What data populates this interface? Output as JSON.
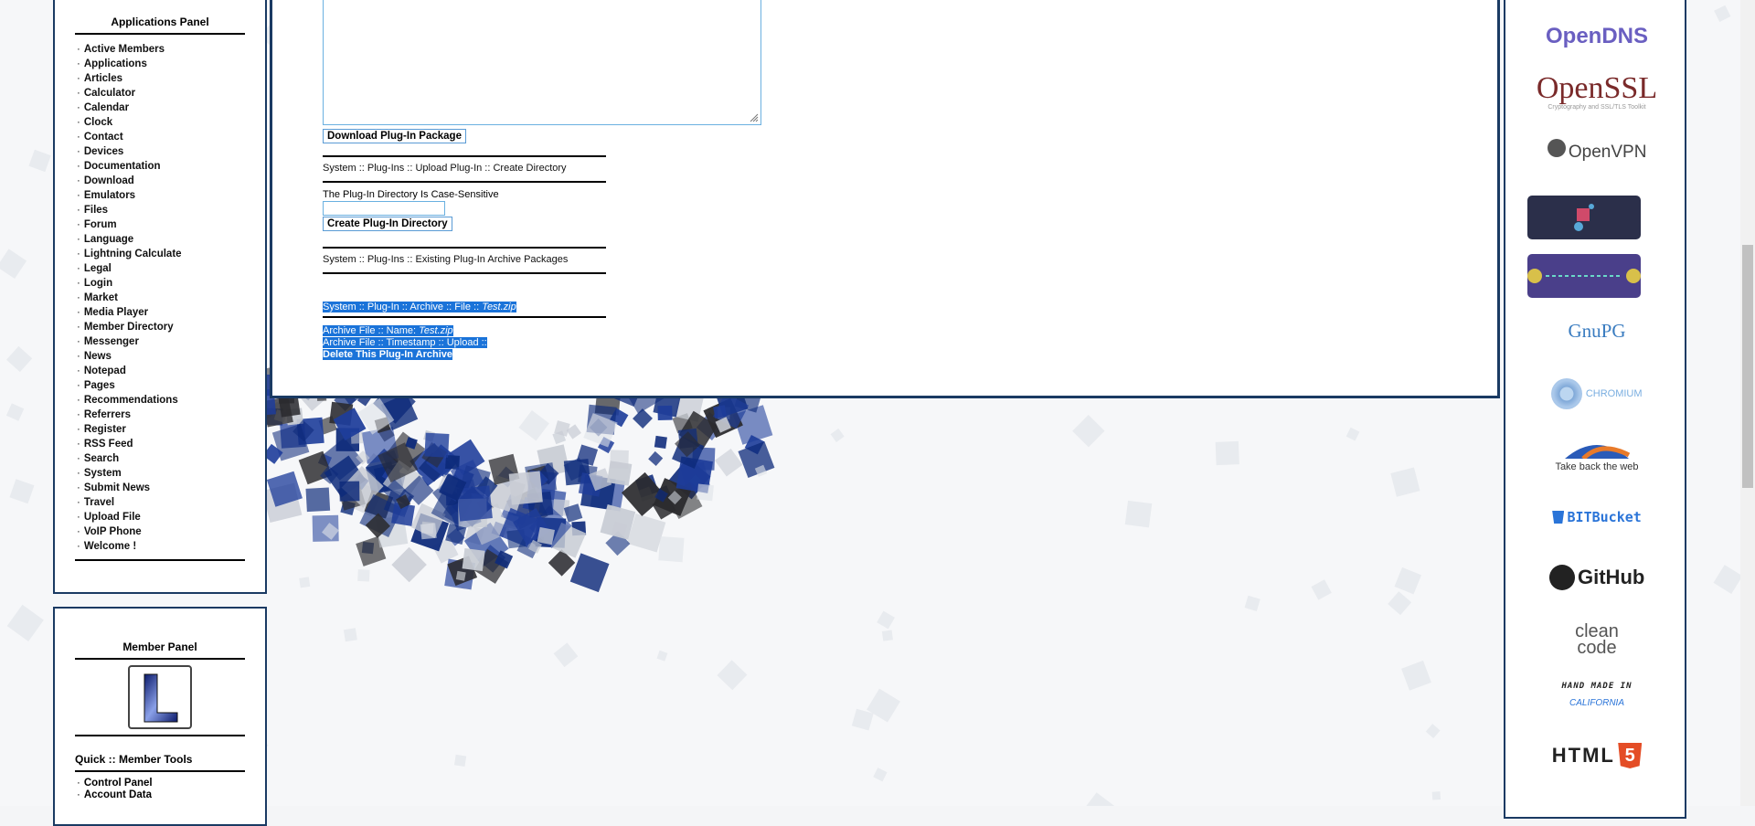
{
  "applications_panel": {
    "title": "Applications Panel",
    "items": [
      "Active Members",
      "Applications",
      "Articles",
      "Calculator",
      "Calendar",
      "Clock",
      "Contact",
      "Devices",
      "Documentation",
      "Download",
      "Emulators",
      "Files",
      "Forum",
      "Language",
      "Lightning Calculate",
      "Legal",
      "Login",
      "Market",
      "Media Player",
      "Member Directory",
      "Messenger",
      "News",
      "Notepad",
      "Pages",
      "Recommendations",
      "Referrers",
      "Register",
      "RSS Feed",
      "Search",
      "System",
      "Submit News",
      "Travel",
      "Upload File",
      "VoIP Phone",
      "Welcome !"
    ],
    "bullet": "·"
  },
  "member_panel": {
    "title": "Member Panel",
    "avatar_letter": "L",
    "quick_tools_title": "Quick :: Member Tools",
    "quick_tools": [
      "Control Panel",
      "Account Data"
    ]
  },
  "main": {
    "download_button": "Download Plug-In Package",
    "create_dir_heading": "System :: Plug-Ins :: Upload Plug-In :: Create Directory",
    "case_note": "The Plug-In Directory Is Case-Sensitive",
    "directory_input_value": "",
    "create_dir_button": "Create Plug-In Directory",
    "existing_heading": "System :: Plug-Ins :: Existing Plug-In Archive Packages",
    "archive_heading_prefix": "System :: Plug-In :: Archive :: File :: ",
    "archive_heading_file": "Test.zip",
    "archive_name_prefix": "Archive File :: Name: ",
    "archive_name_file": "Test.zip",
    "archive_timestamp": "Archive File :: Timestamp :: Upload ::",
    "delete_link": "Delete This Plug-In Archive"
  },
  "sponsors": {
    "opendns": "OpenDNS",
    "openssl": "OpenSSL",
    "openssl_tag": "Cryptography and SSL/TLS Toolkit",
    "openvpn": "OpenVPN",
    "gnupg": "GnuPG",
    "chromium": "CHROMIUM",
    "firefox_tag": "Take back the web",
    "bitbucket": "BITBucket",
    "github": "GitHub",
    "cleancode": "clean code",
    "handmade_1": "HAND MADE IN",
    "handmade_2": "CALIFORNIA",
    "html5": "HTML",
    "html5_badge": "5"
  },
  "colors": {
    "panel_border": "#1a3a63",
    "selection": "#1a73d9",
    "opendns": "#6a5fc1",
    "openssl": "#7a2a2a"
  }
}
